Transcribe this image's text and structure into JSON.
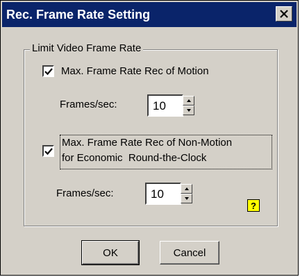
{
  "window": {
    "title": "Rec. Frame Rate Setting",
    "close_label": "✕"
  },
  "group": {
    "label": "Limit Video Frame Rate"
  },
  "motion": {
    "checked": true,
    "label": "Max. Frame Rate Rec of Motion",
    "fps_label": "Frames/sec:",
    "fps_value": "10"
  },
  "non_motion": {
    "checked": true,
    "label_line1": "Max. Frame Rate Rec of Non-Motion",
    "label_line2": "for Economic  Round-the-Clock",
    "fps_label": "Frames/sec:",
    "fps_value": "10"
  },
  "help": {
    "icon": "help-icon",
    "glyph": "?"
  },
  "buttons": {
    "ok": "OK",
    "cancel": "Cancel"
  },
  "colors": {
    "titlebar": "#0a246a",
    "dialog_bg": "#d4d0c8",
    "help_bg": "#ffff00"
  }
}
